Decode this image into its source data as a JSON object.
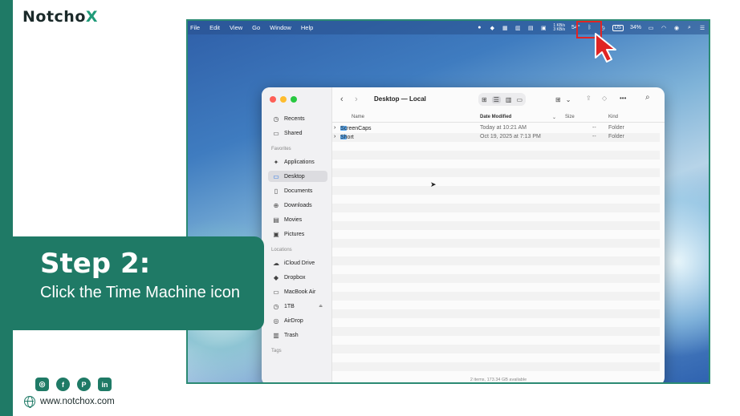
{
  "brand": {
    "logo_text": "Notcho",
    "logo_x": "X",
    "accent": "#1f7a66"
  },
  "menubar": {
    "items": [
      "File",
      "Edit",
      "View",
      "Go",
      "Window",
      "Help"
    ],
    "status": {
      "net_up": "1 KB/s",
      "net_down": "3 KB/s",
      "temp": "54°",
      "lang": "US",
      "battery": "34%"
    }
  },
  "finder": {
    "title": "Desktop — Local",
    "sidebar": {
      "recents": "Recents",
      "shared": "Shared",
      "favorites_head": "Favorites",
      "favorites": [
        {
          "label": "Applications",
          "icon": "apps-icon"
        },
        {
          "label": "Desktop",
          "icon": "desktop-icon"
        },
        {
          "label": "Documents",
          "icon": "document-icon"
        },
        {
          "label": "Downloads",
          "icon": "download-icon"
        },
        {
          "label": "Movies",
          "icon": "film-icon"
        },
        {
          "label": "Pictures",
          "icon": "photo-icon"
        }
      ],
      "locations_head": "Locations",
      "locations": [
        {
          "label": "iCloud Drive",
          "icon": "cloud-icon"
        },
        {
          "label": "Dropbox",
          "icon": "dropbox-icon"
        },
        {
          "label": "MacBook Air",
          "icon": "laptop-icon"
        },
        {
          "label": "1TB",
          "icon": "clock-icon"
        },
        {
          "label": "AirDrop",
          "icon": "airdrop-icon"
        },
        {
          "label": "Trash",
          "icon": "trash-icon"
        }
      ],
      "tags_head": "Tags"
    },
    "columns": {
      "name": "Name",
      "date": "Date Modified",
      "size": "Size",
      "kind": "Kind"
    },
    "rows": [
      {
        "name": "ScreenCaps",
        "date": "Today at 10:21 AM",
        "size": "--",
        "kind": "Folder"
      },
      {
        "name": "Short",
        "date": "Oct 19, 2025 at 7:13 PM",
        "size": "--",
        "kind": "Folder"
      }
    ],
    "status": "2 items, 173.34 GB available"
  },
  "step": {
    "title": "Step 2:",
    "description": "Click the Time Machine icon"
  },
  "footer": {
    "website": "www.notchox.com",
    "social": [
      "instagram-icon",
      "facebook-icon",
      "pinterest-icon",
      "linkedin-icon"
    ]
  }
}
